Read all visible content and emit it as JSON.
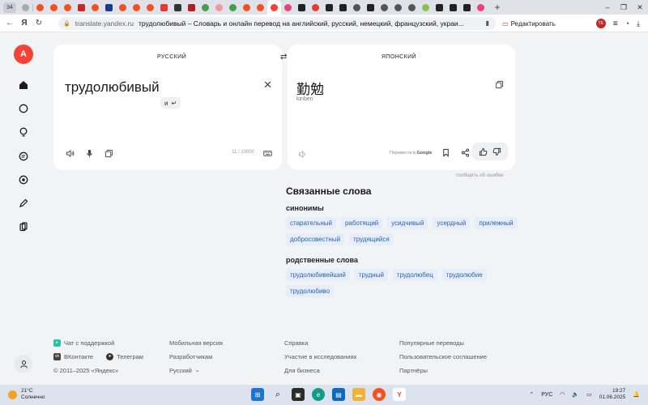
{
  "browser": {
    "tab_count": "34",
    "url_host": "translate.yandex.ru",
    "page_title": "трудолюбивый – Словарь и онлайн перевод на английский, русский, немецкий, французский, украи...",
    "edit_label": "Редактировать",
    "profile_badge": "TE"
  },
  "translator": {
    "source_lang": "РУССКИЙ",
    "target_lang": "ЯПОНСКИЙ",
    "source_text": "трудолюбивый",
    "suggestion": "и",
    "char_count": "11 / 10000",
    "target_text": "勤勉",
    "transliteration": "kinben",
    "translate_via_prefix": "Перевести в",
    "translate_via_brand": "Google",
    "report_error": "сообщить об ошибке"
  },
  "related": {
    "title": "Связанные слова",
    "synonyms_title": "синонимы",
    "synonyms": [
      "старательный",
      "работящий",
      "усидчивый",
      "усердный",
      "прилежный",
      "добросовестный",
      "трудящийся"
    ],
    "cognates_title": "родственные слова",
    "cognates": [
      "трудолюбивейший",
      "трудный",
      "трудолюбец",
      "трудолюбие",
      "трудолюбиво"
    ]
  },
  "footer": {
    "col1": [
      "Чат с поддержкой",
      "ВКонтакте",
      "© 2011–2025 «Яндекс»"
    ],
    "telegram": "Телеграм",
    "col2": [
      "Мобильная версия",
      "Разработчикам",
      "Русский"
    ],
    "col3": [
      "Справка",
      "Участие в исследованиях",
      "Для бизнеса"
    ],
    "col4": [
      "Популярные переводы",
      "Пользовательское соглашение",
      "Партнёры"
    ]
  },
  "taskbar": {
    "temperature": "21°C",
    "weather": "Солнечно",
    "language": "РУС",
    "time": "19:27",
    "date": "01.06.2025"
  },
  "colors": {
    "accent": "#f44336",
    "chip_text": "#2d5fa8",
    "chip_bg": "#e6eefb"
  }
}
